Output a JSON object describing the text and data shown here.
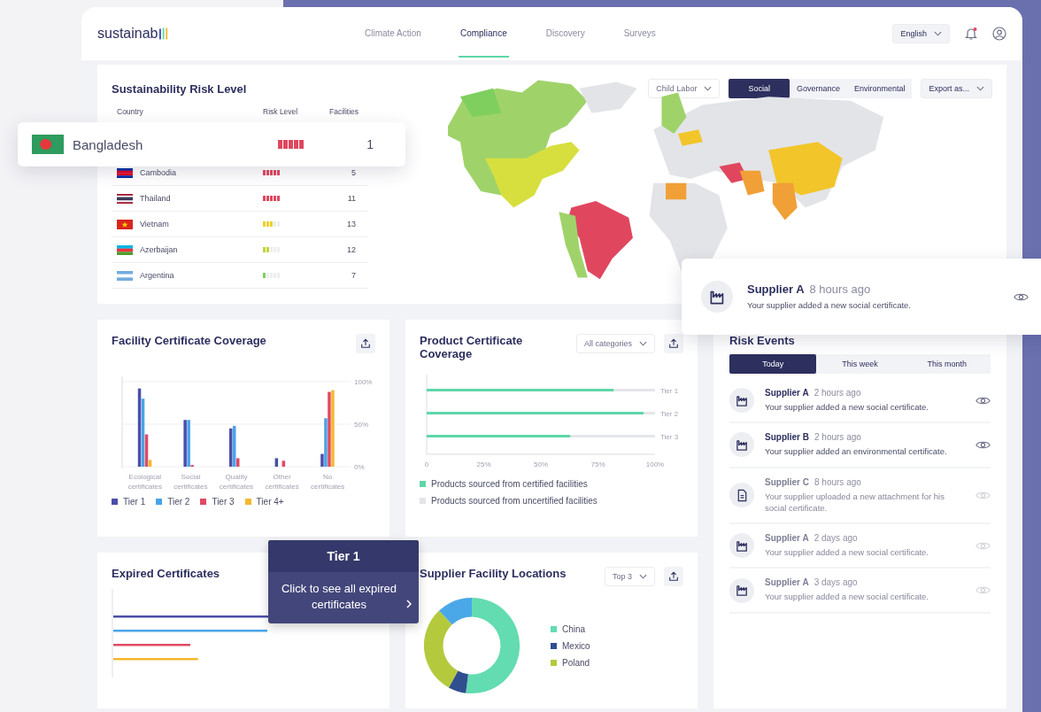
{
  "header": {
    "logo": "sustainab",
    "nav": [
      {
        "label": "Climate Action",
        "selected": false
      },
      {
        "label": "Compliance",
        "selected": true
      },
      {
        "label": "Discovery",
        "selected": false
      },
      {
        "label": "Surveys",
        "selected": false
      }
    ],
    "language": "English",
    "unread": true
  },
  "risk_level": {
    "title": "Sustainability Risk Level",
    "filter": "Child Labor",
    "segments": [
      {
        "label": "Social",
        "selected": true
      },
      {
        "label": "Governance",
        "selected": false
      },
      {
        "label": "Environmental",
        "selected": false
      }
    ],
    "export": "Export as...",
    "columns": [
      "Country",
      "Risk Level",
      "Facilities"
    ],
    "rows": [
      {
        "country": "Cambodia",
        "level": 1,
        "facilities": "5"
      },
      {
        "country": "Thailand",
        "level": 1,
        "facilities": "11"
      },
      {
        "country": "Vietnam",
        "level": 0.6,
        "facilities": "13"
      },
      {
        "country": "Azerbaijan",
        "level": 0.4,
        "facilities": "12"
      },
      {
        "country": "Argentina",
        "level": 0.2,
        "facilities": "7"
      }
    ]
  },
  "highlight": {
    "country": "Bangladesh",
    "level": 1,
    "facilities": "1"
  },
  "facility_coverage": {
    "title": "Facility Certificate Coverage",
    "chart_data": {
      "type": "bar",
      "categories": [
        "Ecological certificates",
        "Social certificates",
        "Quality certificates",
        "Other certificates",
        "No certificates"
      ],
      "series": [
        {
          "name": "Tier 1",
          "color": "#4a4fa8",
          "values": [
            92,
            55,
            45,
            10,
            15
          ]
        },
        {
          "name": "Tier 2",
          "color": "#4aa3e8",
          "values": [
            80,
            55,
            48,
            0,
            57
          ]
        },
        {
          "name": "Tier 3",
          "color": "#e04a63",
          "values": [
            38,
            2,
            10,
            7,
            88
          ]
        },
        {
          "name": "Tier 4+",
          "color": "#f5b731",
          "values": [
            8,
            0,
            0,
            0,
            90
          ]
        }
      ],
      "legend": "bottom",
      "ylim": [
        0,
        100
      ],
      "yticks": [
        {
          "value": 0,
          "label": "0%"
        },
        {
          "value": 50,
          "label": "50%"
        },
        {
          "value": 100,
          "label": "100%"
        }
      ]
    }
  },
  "product_coverage": {
    "title": "Product Certificate Coverage",
    "filter": "All categories",
    "chart_data": {
      "type": "bar",
      "orientation": "horizontal",
      "stacked": true,
      "categories": [
        "Tier 1",
        "Tier 2",
        "Tier 3"
      ],
      "series": [
        {
          "name": "Products sourced from certified facilities",
          "color": "#5fd6a8",
          "values": [
            82,
            95,
            63
          ]
        },
        {
          "name": "Products sourced from uncertified facilities",
          "color": "#e4e5e9",
          "values": [
            18,
            5,
            37
          ]
        }
      ],
      "legend": "bottom",
      "xlim": [
        0,
        100
      ],
      "xticks": [
        {
          "value": 0,
          "label": "0"
        },
        {
          "value": 25,
          "label": "25%"
        },
        {
          "value": 50,
          "label": "50%"
        },
        {
          "value": 75,
          "label": "75%"
        },
        {
          "value": 100,
          "label": "100%"
        }
      ]
    }
  },
  "expired_certificates": {
    "title": "Expired Certificates",
    "bars": [
      {
        "color": "#4a4fa8"
      },
      {
        "color": "#4aa3e8"
      },
      {
        "color": "#e04a63"
      },
      {
        "color": "#f5b731"
      }
    ],
    "tooltip": {
      "title": "Tier 1",
      "text": "Click to see all expired certificates"
    }
  },
  "supplier_locations": {
    "title": "Supplier Facility Locations",
    "filter": "Top 3",
    "legend": [
      {
        "label": "China",
        "color": "#62dcb0"
      },
      {
        "label": "Mexico",
        "color": "#2f4f8f"
      },
      {
        "label": "Poland",
        "color": "#b5c93d"
      }
    ]
  },
  "risk_events": {
    "title": "Risk Events",
    "tabs": [
      {
        "label": "Today",
        "selected": true
      },
      {
        "label": "This week",
        "selected": false
      },
      {
        "label": "This month",
        "selected": false
      }
    ],
    "events": [
      {
        "supplier": "Supplier A",
        "time": "2 hours ago",
        "text": "Your supplier added a new social certificate.",
        "kind": "certificate",
        "dimmed": false
      },
      {
        "supplier": "Supplier B",
        "time": "2 hours ago",
        "text": "Your supplier added an environmental certificate.",
        "kind": "certificate",
        "dimmed": false
      },
      {
        "supplier": "Supplier C",
        "time": "8 hours ago",
        "text": "Your supplier uploaded a new attachment for his social certificate.",
        "kind": "attachment",
        "dimmed": true
      },
      {
        "supplier": "Supplier A",
        "time": "2 days ago",
        "text": "Your supplier added a new social certificate.",
        "kind": "certificate",
        "dimmed": true
      },
      {
        "supplier": "Supplier A",
        "time": "3 days ago",
        "text": "Your supplier added a new social certificate.",
        "kind": "certificate",
        "dimmed": true
      }
    ]
  },
  "notification": {
    "supplier": "Supplier A",
    "time": "8 hours ago",
    "text": "Your supplier added a new social certificate.",
    "kind": "certificate"
  }
}
